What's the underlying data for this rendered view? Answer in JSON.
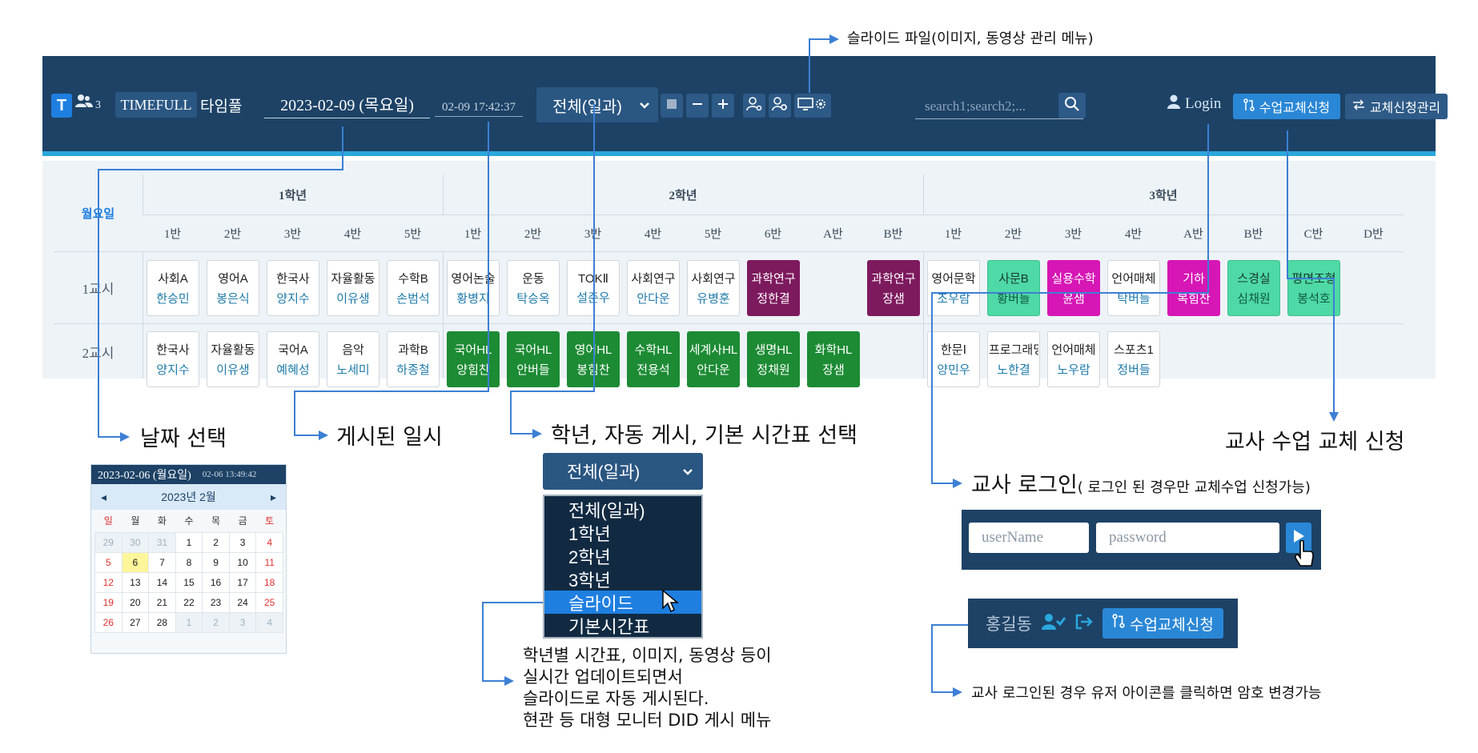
{
  "header": {
    "logo_letter": "T",
    "user_count": "3",
    "brand": "TIMEFULL",
    "brand_ko": "타임풀",
    "date": "2023-02-09 (목요일)",
    "published_at": "02-09 17:42:37",
    "view_select": "전체(일과)",
    "search_placeholder": "search1;search2;...",
    "login": "Login",
    "substitute_request": "수업교체신청",
    "substitute_manage": "교체신청관리"
  },
  "timetable": {
    "day": "월요일",
    "grades": [
      "1학년",
      "2학년",
      "3학년"
    ],
    "grade1_classes": [
      "1반",
      "2반",
      "3반",
      "4반",
      "5반"
    ],
    "grade2_classes": [
      "1반",
      "2반",
      "3반",
      "4반",
      "5반",
      "6반",
      "A반",
      "B반"
    ],
    "grade3_classes": [
      "1반",
      "2반",
      "3반",
      "4반",
      "A반",
      "B반",
      "C반",
      "D반"
    ],
    "periods": [
      "1교시",
      "2교시"
    ],
    "row1": [
      {
        "s": "사회A",
        "t": "한승민",
        "c": "plain"
      },
      {
        "s": "영어A",
        "t": "봉은식",
        "c": "plain"
      },
      {
        "s": "한국사",
        "t": "양지수",
        "c": "plain"
      },
      {
        "s": "자율활동",
        "t": "이유생",
        "c": "plain"
      },
      {
        "s": "수학B",
        "t": "손범석",
        "c": "plain"
      },
      {
        "s": "영어논술",
        "t": "황병지",
        "c": "plain"
      },
      {
        "s": "운동",
        "t": "탁승옥",
        "c": "plain"
      },
      {
        "s": "TOKⅡ",
        "t": "설준우",
        "c": "plain"
      },
      {
        "s": "사회연구",
        "t": "안다운",
        "c": "plain"
      },
      {
        "s": "사회연구",
        "t": "유병훈",
        "c": "plain"
      },
      {
        "s": "과학연구",
        "t": "정한결",
        "c": "purple"
      },
      {
        "s": "",
        "t": "",
        "c": "empty"
      },
      {
        "s": "과학연구",
        "t": "장샘",
        "c": "purple"
      },
      {
        "s": "영어문학",
        "t": "조우람",
        "c": "plain"
      },
      {
        "s": "사문B",
        "t": "황버들",
        "c": "mint"
      },
      {
        "s": "실용수학",
        "t": "윤샘",
        "c": "magenta"
      },
      {
        "s": "언어매체",
        "t": "탁버들",
        "c": "plain"
      },
      {
        "s": "기하",
        "t": "복힘찬",
        "c": "magenta"
      },
      {
        "s": "스경실",
        "t": "심채원",
        "c": "mint"
      },
      {
        "s": "평면조형",
        "t": "봉석호",
        "c": "mint"
      },
      {
        "s": "",
        "t": "",
        "c": "empty"
      }
    ],
    "row2": [
      {
        "s": "한국사",
        "t": "양지수",
        "c": "plain"
      },
      {
        "s": "자율활동",
        "t": "이유생",
        "c": "plain"
      },
      {
        "s": "국어A",
        "t": "예혜성",
        "c": "plain"
      },
      {
        "s": "음악",
        "t": "노세미",
        "c": "plain"
      },
      {
        "s": "과학B",
        "t": "하종철",
        "c": "plain"
      },
      {
        "s": "국어HL",
        "t": "양힘찬",
        "c": "green"
      },
      {
        "s": "국어HL",
        "t": "안버들",
        "c": "green"
      },
      {
        "s": "영어HL",
        "t": "봉힘찬",
        "c": "green"
      },
      {
        "s": "수학HL",
        "t": "전용석",
        "c": "green"
      },
      {
        "s": "세계사HL",
        "t": "안다운",
        "c": "green"
      },
      {
        "s": "생명HL",
        "t": "정채원",
        "c": "green"
      },
      {
        "s": "화학HL",
        "t": "장샘",
        "c": "green"
      },
      {
        "s": "",
        "t": "",
        "c": "empty"
      },
      {
        "s": "한문Ⅰ",
        "t": "양민우",
        "c": "plain"
      },
      {
        "s": "프로그래밍",
        "t": "노한결",
        "c": "plain"
      },
      {
        "s": "언어매체",
        "t": "노우람",
        "c": "plain"
      },
      {
        "s": "스포츠1",
        "t": "정버들",
        "c": "plain"
      },
      {
        "s": "",
        "t": "",
        "c": "empty"
      },
      {
        "s": "",
        "t": "",
        "c": "empty"
      },
      {
        "s": "",
        "t": "",
        "c": "empty"
      },
      {
        "s": "",
        "t": "",
        "c": "empty"
      }
    ]
  },
  "annotations": {
    "slide_file": "슬라이드 파일(이미지, 동영상 관리 메뉴)",
    "date_select": "날짜 선택",
    "published": "게시된 일시",
    "grade_select": "학년, 자동 게시, 기본 시간표 선택",
    "teacher_login": "교사 로그인",
    "teacher_login_note": "( 로그인 된 경우만 교체수업 신청가능)",
    "substitute": "교사 수업 교체 신청",
    "password_change": "교사 로그인된 경우 유저 아이콘를 클릭하면 암호 변경가능",
    "slide_desc": [
      "학년별 시간표, 이미지, 동영상 등이",
      "실시간 업데이트되면서",
      "슬라이드로 자동 게시된다.",
      "현관 등 대형 모니터 DID 게시 메뉴"
    ]
  },
  "calendar": {
    "date": "2023-02-06 (월요일)",
    "published_at": "02-06 13:49:42",
    "month": "2023년 2월",
    "weekdays": [
      "일",
      "월",
      "화",
      "수",
      "목",
      "금",
      "토"
    ],
    "weeks": [
      [
        "29",
        "30",
        "31",
        "1",
        "2",
        "3",
        "4"
      ],
      [
        "5",
        "6",
        "7",
        "8",
        "9",
        "10",
        "11"
      ],
      [
        "12",
        "13",
        "14",
        "15",
        "16",
        "17",
        "18"
      ],
      [
        "19",
        "20",
        "21",
        "22",
        "23",
        "24",
        "25"
      ],
      [
        "26",
        "27",
        "28",
        "1",
        "2",
        "3",
        "4"
      ]
    ]
  },
  "dropdown": {
    "selected": "전체(일과)",
    "options": [
      "전체(일과)",
      "1학년",
      "2학년",
      "3학년",
      "슬라이드",
      "기본시간표"
    ],
    "highlighted": "슬라이드"
  },
  "login_form": {
    "username_placeholder": "userName",
    "password_placeholder": "password"
  },
  "logged_in": {
    "name": "홍길동",
    "button": "수업교체신청"
  },
  "colors": {
    "header": "#1d4266",
    "accent": "#2aa7dc",
    "button": "#2a87d6",
    "annotation_line": "#3c7fd4",
    "cell_purple": "#7d1a5e",
    "cell_mint": "#4ed9a6",
    "cell_magenta": "#d616b5",
    "cell_green": "#1c8b34"
  }
}
